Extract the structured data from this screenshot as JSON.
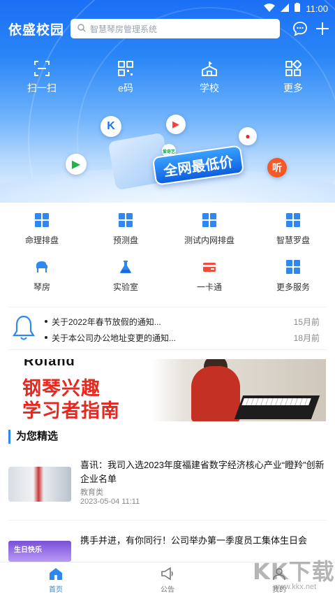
{
  "status_bar": {
    "time": "11:00"
  },
  "app": {
    "name": "依盛校园"
  },
  "search": {
    "placeholder": "智慧琴房管理系统"
  },
  "quick_actions": [
    {
      "label": "扫一扫",
      "icon": "scan-icon"
    },
    {
      "label": "e码",
      "icon": "qrcode-icon"
    },
    {
      "label": "学校",
      "icon": "school-icon"
    },
    {
      "label": "更多",
      "icon": "more-apps-icon"
    }
  ],
  "promo": {
    "badge": "全网最低价",
    "app_badges": [
      "K",
      "▶",
      "爱奇艺",
      "听"
    ]
  },
  "services": [
    {
      "label": "命理排盘",
      "icon": "grid-icon"
    },
    {
      "label": "预测盘",
      "icon": "grid-icon"
    },
    {
      "label": "测试内网排盘",
      "icon": "grid-icon"
    },
    {
      "label": "智慧罗盘",
      "icon": "grid-icon"
    },
    {
      "label": "琴房",
      "icon": "piano-icon"
    },
    {
      "label": "实验室",
      "icon": "flask-icon"
    },
    {
      "label": "一卡通",
      "icon": "card-icon"
    },
    {
      "label": "更多服务",
      "icon": "grid-icon"
    }
  ],
  "notices": [
    {
      "text": "关于2022年春节放假的通知...",
      "time": "15月前"
    },
    {
      "text": "关于本公司办公地址变更的通知...",
      "time": "18月前"
    }
  ],
  "banner": {
    "brand": "Roland",
    "line1": "钢琴兴趣",
    "line2": "学习者指南"
  },
  "featured": {
    "title": "为您精选",
    "articles": [
      {
        "title": "喜讯：我司入选2023年度福建省数字经济核心产业“瞪羚”创新企业名单",
        "category": "教育类",
        "date": "2023-05-04 11:11"
      },
      {
        "title": "携手并进，有你同行！公司举办第一季度员工集体生日会",
        "thumb_text": "生日快乐"
      }
    ]
  },
  "bottom_nav": [
    {
      "label": "首页",
      "active": true
    },
    {
      "label": "公告",
      "active": false
    },
    {
      "label": "我的",
      "active": false
    }
  ],
  "watermark": {
    "text": "KK下载",
    "url": "www.kkx.net"
  },
  "colors": {
    "primary": "#2e88f0",
    "hero_top": "#1b6ff5",
    "banner_red": "#e8281f"
  }
}
